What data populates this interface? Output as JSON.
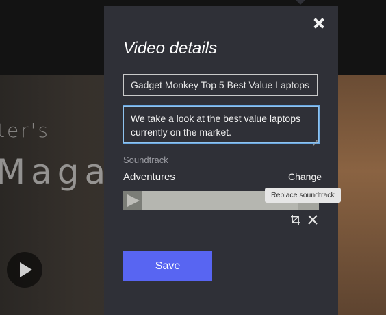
{
  "background": {
    "text_line_1": "ter's",
    "text_line_2": "Magazi",
    "play_icon": "play-icon"
  },
  "dialog": {
    "title": "Video details",
    "close_icon": "close-icon",
    "video_title_value": "Gadget Monkey Top 5 Best Value Laptops",
    "description_value": "We take a look at the best value laptops currently on the market.",
    "soundtrack": {
      "label": "Soundtrack",
      "track_name": "Adventures",
      "change_label": "Change",
      "tooltip": "Replace soundtrack",
      "progress": 0.88,
      "crop_icon": "crop-icon",
      "remove_icon": "close-icon"
    },
    "save_label": "Save"
  },
  "colors": {
    "panel_bg": "#2f3037",
    "accent": "#5865f2",
    "focus_border": "#8fc3ef"
  }
}
